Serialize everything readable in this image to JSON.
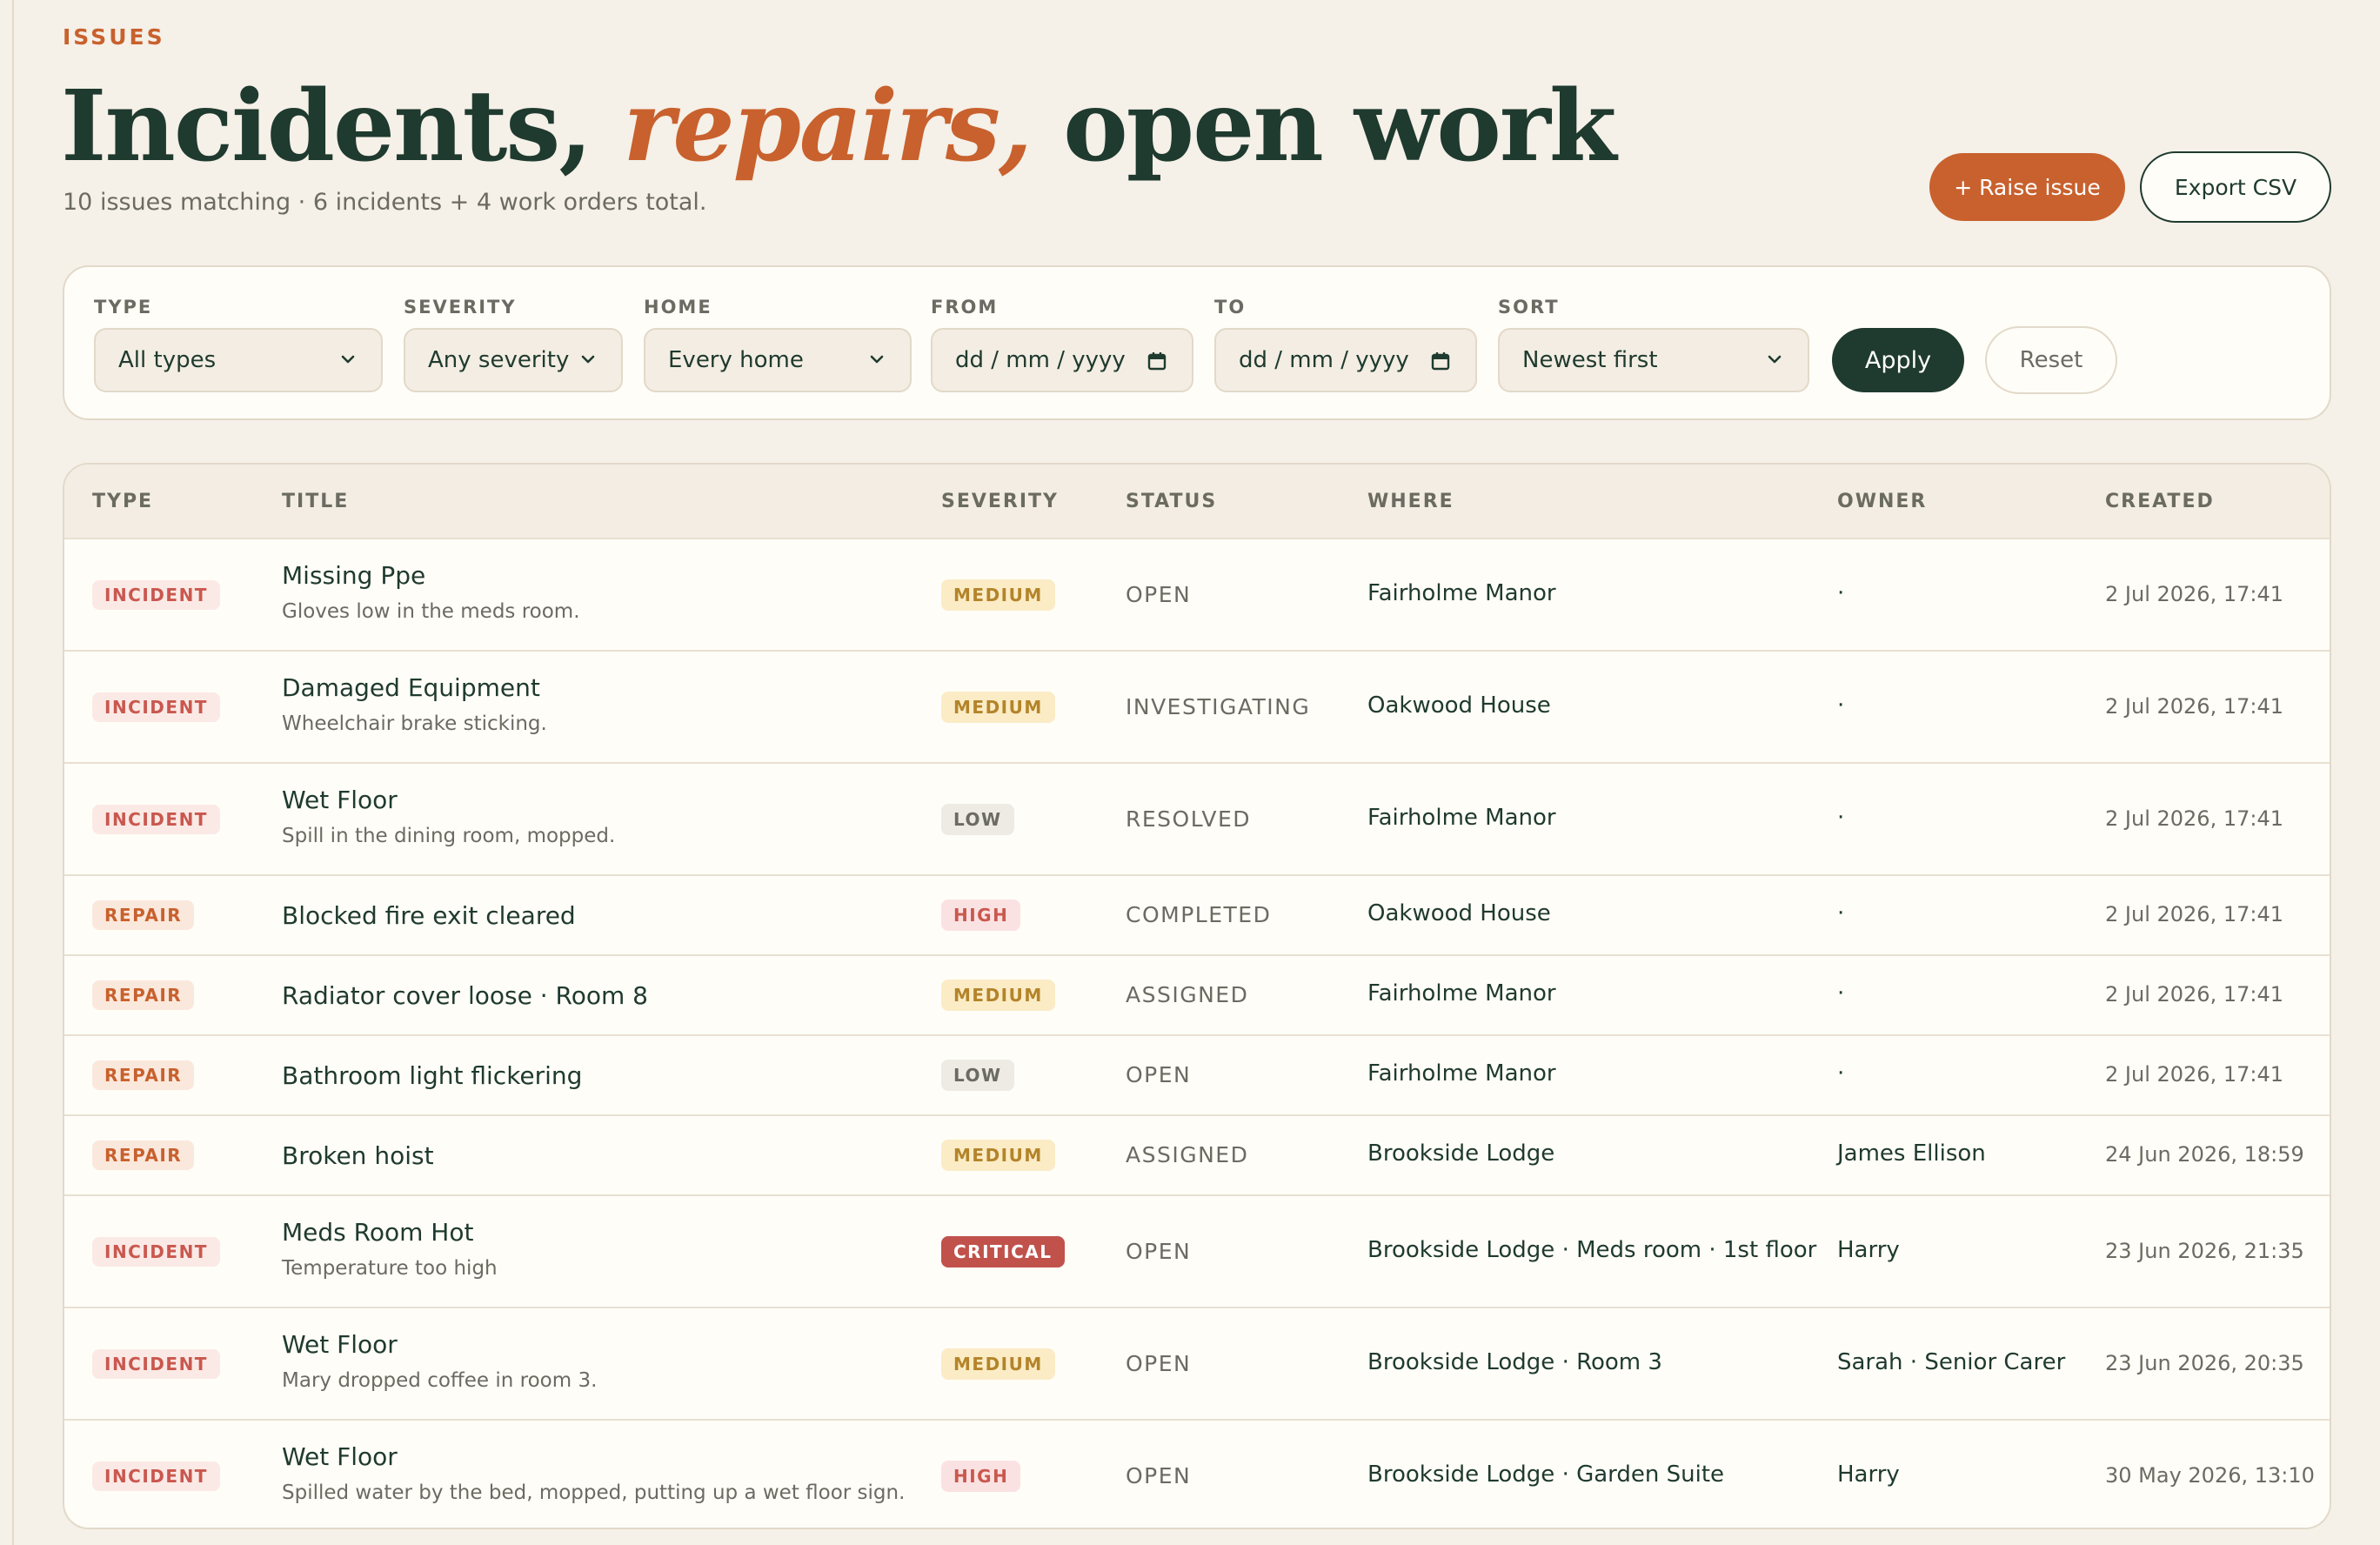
{
  "header": {
    "eyebrow": "ISSUES",
    "title_part1": "Incidents, ",
    "title_accent": "repairs,",
    "title_part2": " open work",
    "subtitle": "10 issues matching · 6 incidents + 4 work orders total."
  },
  "actions": {
    "raise_label": "+ Raise issue",
    "export_label": "Export CSV"
  },
  "filters": {
    "type": {
      "label": "TYPE",
      "value": "All types"
    },
    "severity": {
      "label": "SEVERITY",
      "value": "Any severity"
    },
    "home": {
      "label": "HOME",
      "value": "Every home"
    },
    "from": {
      "label": "FROM",
      "placeholder": "dd / mm / yyyy"
    },
    "to": {
      "label": "TO",
      "placeholder": "dd / mm / yyyy"
    },
    "sort": {
      "label": "SORT",
      "value": "Newest first"
    },
    "apply_label": "Apply",
    "reset_label": "Reset"
  },
  "table": {
    "columns": [
      "TYPE",
      "TITLE",
      "SEVERITY",
      "STATUS",
      "WHERE",
      "OWNER",
      "CREATED"
    ],
    "rows": [
      {
        "type": "INCIDENT",
        "title": "Missing Ppe",
        "subtitle": "Gloves low in the meds room.",
        "severity": "MEDIUM",
        "status": "OPEN",
        "where": "Fairholme Manor",
        "owner": "·",
        "created": "2 Jul 2026, 17:41"
      },
      {
        "type": "INCIDENT",
        "title": "Damaged Equipment",
        "subtitle": "Wheelchair brake sticking.",
        "severity": "MEDIUM",
        "status": "INVESTIGATING",
        "where": "Oakwood House",
        "owner": "·",
        "created": "2 Jul 2026, 17:41"
      },
      {
        "type": "INCIDENT",
        "title": "Wet Floor",
        "subtitle": "Spill in the dining room, mopped.",
        "severity": "LOW",
        "status": "RESOLVED",
        "where": "Fairholme Manor",
        "owner": "·",
        "created": "2 Jul 2026, 17:41"
      },
      {
        "type": "REPAIR",
        "title": "Blocked fire exit cleared",
        "subtitle": "",
        "severity": "HIGH",
        "status": "COMPLETED",
        "where": "Oakwood House",
        "owner": "·",
        "created": "2 Jul 2026, 17:41"
      },
      {
        "type": "REPAIR",
        "title": "Radiator cover loose · Room 8",
        "subtitle": "",
        "severity": "MEDIUM",
        "status": "ASSIGNED",
        "where": "Fairholme Manor",
        "owner": "·",
        "created": "2 Jul 2026, 17:41"
      },
      {
        "type": "REPAIR",
        "title": "Bathroom light flickering",
        "subtitle": "",
        "severity": "LOW",
        "status": "OPEN",
        "where": "Fairholme Manor",
        "owner": "·",
        "created": "2 Jul 2026, 17:41"
      },
      {
        "type": "REPAIR",
        "title": "Broken hoist",
        "subtitle": "",
        "severity": "MEDIUM",
        "status": "ASSIGNED",
        "where": "Brookside Lodge",
        "owner": "James Ellison",
        "created": "24 Jun 2026, 18:59"
      },
      {
        "type": "INCIDENT",
        "title": "Meds Room Hot",
        "subtitle": "Temperature too high",
        "severity": "CRITICAL",
        "status": "OPEN",
        "where": "Brookside Lodge · Meds room · 1st floor",
        "owner": "Harry",
        "created": "23 Jun 2026, 21:35"
      },
      {
        "type": "INCIDENT",
        "title": "Wet Floor",
        "subtitle": "Mary dropped coffee in room 3.",
        "severity": "MEDIUM",
        "status": "OPEN",
        "where": "Brookside Lodge · Room 3",
        "owner": "Sarah · Senior Carer",
        "created": "23 Jun 2026, 20:35"
      },
      {
        "type": "INCIDENT",
        "title": "Wet Floor",
        "subtitle": "Spilled water by the bed, mopped, putting up a wet floor sign.",
        "severity": "HIGH",
        "status": "OPEN",
        "where": "Brookside Lodge · Garden Suite",
        "owner": "Harry",
        "created": "30 May 2026, 13:10"
      }
    ]
  }
}
